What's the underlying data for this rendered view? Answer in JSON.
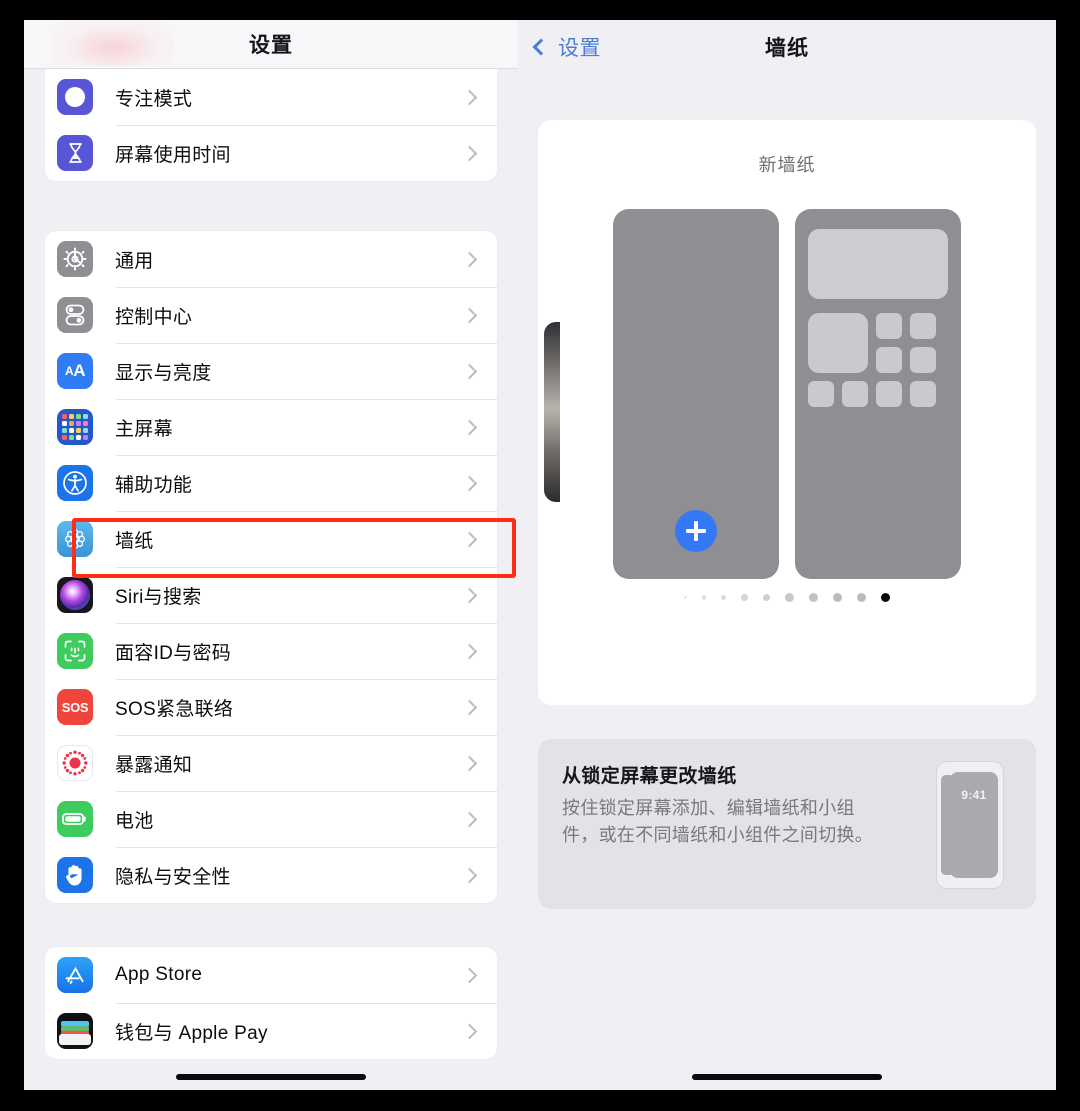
{
  "left": {
    "header_title": "设置",
    "groups": [
      {
        "id": "group-focus",
        "items": [
          {
            "label": "专注模式",
            "icon": "moon-icon"
          },
          {
            "label": "屏幕使用时间",
            "icon": "hourglass-icon"
          }
        ]
      },
      {
        "id": "group-system",
        "items": [
          {
            "label": "通用",
            "icon": "gear-icon"
          },
          {
            "label": "控制中心",
            "icon": "control-center-icon"
          },
          {
            "label": "显示与亮度",
            "icon": "display-brightness-icon"
          },
          {
            "label": "主屏幕",
            "icon": "home-screen-icon"
          },
          {
            "label": "辅助功能",
            "icon": "accessibility-icon"
          },
          {
            "label": "墙纸",
            "icon": "wallpaper-icon"
          },
          {
            "label": "Siri与搜索",
            "icon": "siri-icon"
          },
          {
            "label": "面容ID与密码",
            "icon": "face-id-icon"
          },
          {
            "label": "SOS紧急联络",
            "icon": "sos-icon"
          },
          {
            "label": "暴露通知",
            "icon": "exposure-notification-icon"
          },
          {
            "label": "电池",
            "icon": "battery-icon"
          },
          {
            "label": "隐私与安全性",
            "icon": "privacy-hand-icon"
          }
        ]
      },
      {
        "id": "group-store",
        "items": [
          {
            "label": "App Store",
            "icon": "app-store-icon"
          },
          {
            "label": "钱包与 Apple Pay",
            "icon": "wallet-icon"
          }
        ]
      }
    ],
    "highlighted_item": "墙纸"
  },
  "right": {
    "back_label": "设置",
    "title": "墙纸",
    "wallpaper_card": {
      "title": "新墙纸",
      "add_button_label": "+",
      "page_dots_total": 10,
      "page_dots_active_index": 9
    },
    "info_card": {
      "title": "从锁定屏幕更改墙纸",
      "description": "按住锁定屏幕添加、编辑墙纸和小组件，或在不同墙纸和小组件之间切换。",
      "phone_preview_time": "9:41"
    }
  },
  "colors": {
    "accent_blue": "#3478f6",
    "link_blue": "#4a7ed8",
    "highlight_red": "#ff2d16",
    "panel_bg": "#efeff4",
    "card_bg": "#ffffff",
    "info_card_bg": "#e3e3e7"
  }
}
